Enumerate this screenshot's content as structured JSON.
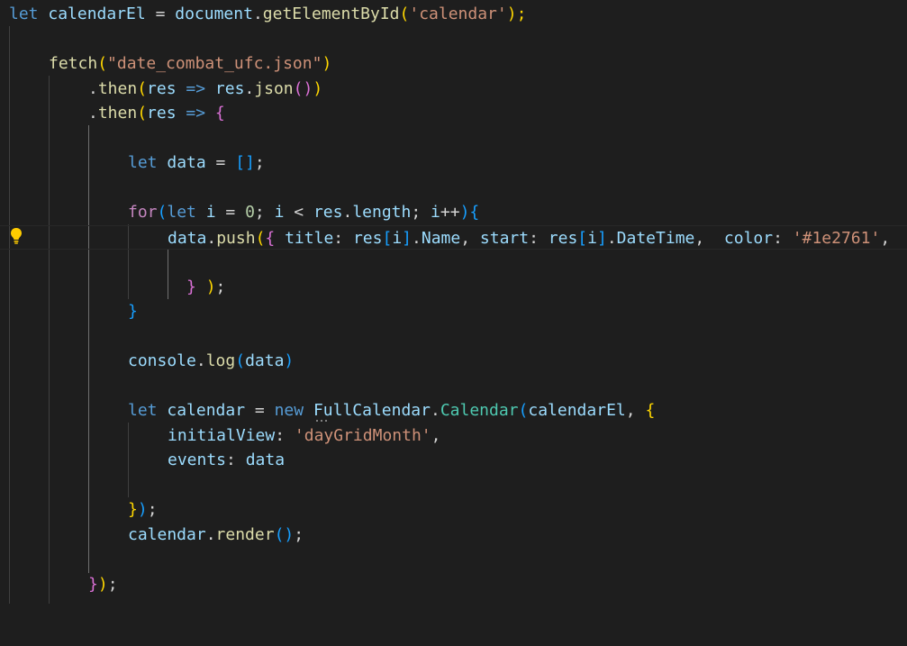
{
  "editor": {
    "line1": {
      "t1": "let",
      "t2": " ",
      "t3": "calendarEl",
      "t4": " = ",
      "t5": "document",
      "t6": ".",
      "t7": "getElementById",
      "t8": "(",
      "t9": "'calendar'",
      "t10": ");"
    },
    "line3": {
      "t1": "fetch",
      "t2": "(",
      "t3": "\"date_combat_ufc.json\"",
      "t4": ")"
    },
    "line4": {
      "t1": ".",
      "t2": "then",
      "t3": "(",
      "t4": "res",
      "t5": " => ",
      "t6": "res",
      "t7": ".",
      "t8": "json",
      "t9": "()",
      "t10": ")"
    },
    "line5": {
      "t1": ".",
      "t2": "then",
      "t3": "(",
      "t4": "res",
      "t5": " => ",
      "t6": "{"
    },
    "line7": {
      "t1": "let",
      "t2": " ",
      "t3": "data",
      "t4": " = ",
      "t5": "[]",
      "t6": ";"
    },
    "line9": {
      "t1": "for",
      "t2": "(",
      "t3": "let",
      "t4": " ",
      "t5": "i",
      "t6": " = ",
      "t7": "0",
      "t8": "; ",
      "t9": "i",
      "t10": " < ",
      "t11": "res",
      "t12": ".",
      "t13": "length",
      "t14": "; ",
      "t15": "i",
      "t16": "++",
      "t17": ")",
      "t18": "{"
    },
    "line10": {
      "t1": "data",
      "t2": ".",
      "t3": "push",
      "t4": "(",
      "t5": "{",
      "t6": " ",
      "t7": "title",
      "t8": ": ",
      "t9": "res",
      "t10": "[",
      "t11": "i",
      "t12": "]",
      "t13": ".",
      "t14": "Name",
      "t15": ", ",
      "t16": "start",
      "t17": ": ",
      "t18": "res",
      "t19": "[",
      "t20": "i",
      "t21": "]",
      "t22": ".",
      "t23": "DateTime",
      "t24": ",  ",
      "t25": "color",
      "t26": ": ",
      "t27": "'#1e2761'",
      "t28": ","
    },
    "line12": {
      "t1": "}",
      "t2": " ",
      "t3": ")",
      "t4": ";"
    },
    "line13": {
      "t1": "}"
    },
    "line15": {
      "t1": "console",
      "t2": ".",
      "t3": "log",
      "t4": "(",
      "t5": "data",
      "t6": ")"
    },
    "line17": {
      "t1": "let",
      "t2": " ",
      "t3": "calendar",
      "t4": " = ",
      "t5": "new",
      "t6": " ",
      "t7": "FullCalendar",
      "t8": ".",
      "t9": "Calendar",
      "t10": "(",
      "t11": "calendarEl",
      "t12": ", ",
      "t13": "{"
    },
    "line18": {
      "t1": "initialView",
      "t2": ": ",
      "t3": "'dayGridMonth'",
      "t4": ","
    },
    "line19": {
      "t1": "events",
      "t2": ": ",
      "t3": "data"
    },
    "line21": {
      "t1": "}",
      "t2": ")",
      "t3": ";"
    },
    "line22": {
      "t1": "calendar",
      "t2": ".",
      "t3": "render",
      "t4": "()",
      "t5": ";"
    },
    "line24": {
      "t1": "}",
      "t2": ")",
      "t3": ";"
    }
  },
  "theme": {
    "background": "#1e1e1e",
    "keyword": "#569cd6",
    "control": "#c586c0",
    "variable": "#9cdcfe",
    "function": "#dcdcaa",
    "string": "#ce9178",
    "number": "#b5cea8",
    "class": "#4ec9b0",
    "bracket_level_1": "#ffd700",
    "bracket_level_2": "#da70d6",
    "bracket_level_3": "#179fff"
  },
  "icons": {
    "gutter": "lightbulb-icon"
  }
}
